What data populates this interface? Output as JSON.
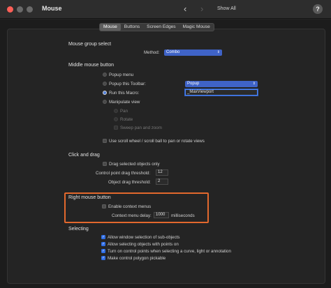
{
  "window": {
    "title": "Mouse",
    "show_all": "Show All",
    "help": "?"
  },
  "tabs": [
    "Mouse",
    "Buttons",
    "Screen Edges",
    "Magic Mouse"
  ],
  "mouse_group": {
    "heading": "Mouse group select",
    "method_label": "Method:",
    "method_value": "Combo"
  },
  "middle_button": {
    "heading": "Middle mouse button",
    "popup_menu": "Popup menu",
    "popup_toolbar": "Popup this Toolbar:",
    "toolbar_value": "Popup",
    "run_macro": "Run this Macro:",
    "macro_value": "_MaxViewport",
    "manipulate_view": "Manipulate view",
    "pan": "Pan",
    "rotate": "Rotate",
    "sweep": "Sweep pan and zoom",
    "scroll_wheel": "Use scroll wheel / scroll ball to pan or rotate views"
  },
  "click_drag": {
    "heading": "Click and drag",
    "drag_selected": "Drag selected objects only",
    "cp_threshold_label": "Control point drag threshold:",
    "cp_threshold_value": "12",
    "obj_threshold_label": "Object drag threshold:",
    "obj_threshold_value": "2"
  },
  "right_button": {
    "heading": "Right mouse button",
    "enable_context": "Enable context menus",
    "delay_label": "Context menu delay:",
    "delay_value": "1000",
    "delay_unit": "milliseconds"
  },
  "selecting": {
    "heading": "Selecting",
    "items": [
      "Allow window selection of sub-objects",
      "Allow selecting objects with points on",
      "Turn on control points when selecting a curve, light or annotation",
      "Make control polygon pickable"
    ]
  },
  "colors": {
    "highlight": "#e2682d",
    "accent": "#2f6ee6",
    "close": "#ff5f57"
  }
}
